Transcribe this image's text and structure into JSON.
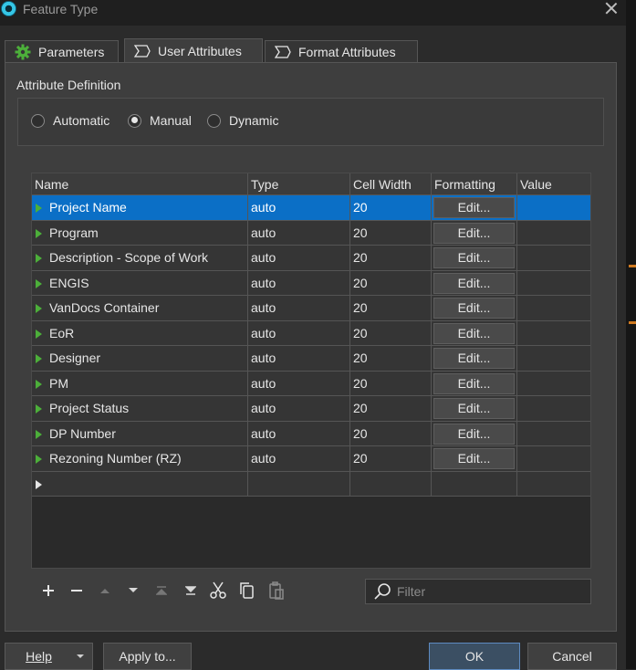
{
  "window": {
    "title": "Feature Type"
  },
  "tabs": [
    {
      "label": "Parameters"
    },
    {
      "label": "User Attributes"
    },
    {
      "label": "Format Attributes"
    }
  ],
  "attribute_definition": {
    "label": "Attribute Definition",
    "options": [
      "Automatic",
      "Manual",
      "Dynamic"
    ],
    "selected": "Manual"
  },
  "table": {
    "columns": [
      "Name",
      "Type",
      "Cell Width",
      "Formatting",
      "Value"
    ],
    "edit_label": "Edit...",
    "rows": [
      {
        "name": "Project Name",
        "type": "auto",
        "width": "20"
      },
      {
        "name": "Program",
        "type": "auto",
        "width": "20"
      },
      {
        "name": "Description - Scope of Work",
        "type": "auto",
        "width": "20"
      },
      {
        "name": "ENGIS",
        "type": "auto",
        "width": "20"
      },
      {
        "name": "VanDocs Container",
        "type": "auto",
        "width": "20"
      },
      {
        "name": "EoR",
        "type": "auto",
        "width": "20"
      },
      {
        "name": "Designer",
        "type": "auto",
        "width": "20"
      },
      {
        "name": "PM",
        "type": "auto",
        "width": "20"
      },
      {
        "name": "Project Status",
        "type": "auto",
        "width": "20"
      },
      {
        "name": "DP Number",
        "type": "auto",
        "width": "20"
      },
      {
        "name": "Rezoning Number (RZ)",
        "type": "auto",
        "width": "20"
      }
    ]
  },
  "toolbar": {
    "icons": [
      "plus-icon",
      "minus-icon",
      "move-up-icon",
      "move-down-icon",
      "move-top-icon",
      "move-bottom-icon",
      "cut-icon",
      "copy-icon",
      "paste-icon"
    ]
  },
  "filter": {
    "placeholder": "Filter"
  },
  "buttons": {
    "help": "Help",
    "apply_to": "Apply to...",
    "ok": "OK",
    "cancel": "Cancel"
  },
  "colors": {
    "selection": "#0b6fc6",
    "accent_green": "#4caf3a",
    "background": "#2b2b2b"
  }
}
